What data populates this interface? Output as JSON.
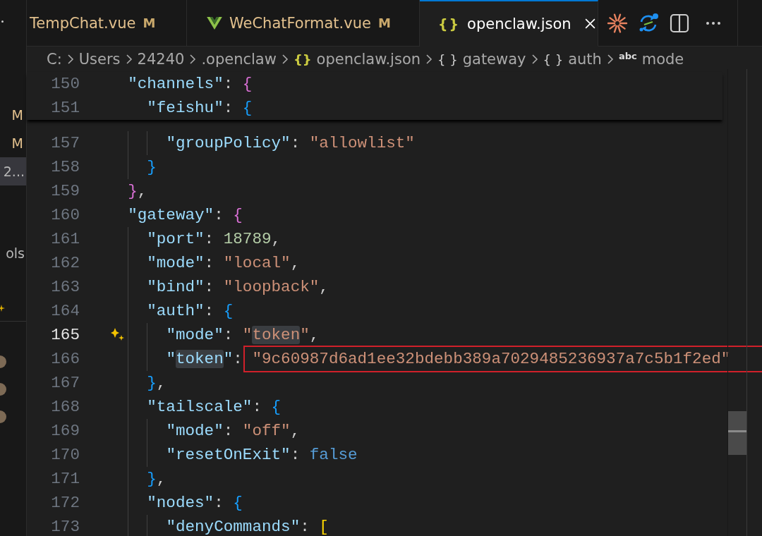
{
  "sidebar": {
    "items": [
      {
        "label": "M",
        "kind": "badge",
        "selected": false
      },
      {
        "label": "M",
        "kind": "badge",
        "selected": false
      },
      {
        "label": "2...",
        "kind": "entry",
        "selected": true
      },
      {
        "label": "ols",
        "kind": "entry",
        "selected": false
      }
    ]
  },
  "tabs": [
    {
      "label": "TempChat.vue",
      "badge": "M",
      "kind": "vue-cut",
      "selected": false
    },
    {
      "label": "WeChatFormat.vue",
      "badge": "M",
      "kind": "vue",
      "selected": false
    },
    {
      "label": "openclaw.json",
      "glyph": "{}",
      "kind": "json",
      "selected": true
    }
  ],
  "breadcrumb": [
    {
      "label": "C:"
    },
    {
      "label": "Users"
    },
    {
      "label": "24240"
    },
    {
      "label": ".openclaw"
    },
    {
      "glyph": "{}",
      "kind": "file",
      "label": "openclaw.json"
    },
    {
      "glyph": "{ }",
      "kind": "object",
      "label": "gateway"
    },
    {
      "glyph": "{ }",
      "kind": "object",
      "label": "auth"
    },
    {
      "glyph": "abc",
      "kind": "string",
      "label": "mode"
    }
  ],
  "sticky_lines": [
    {
      "number": "150",
      "tokens": [
        {
          "kind": "key",
          "text": "  \"channels\""
        },
        {
          "kind": "punct",
          "text": ": "
        },
        {
          "kind": "bracket",
          "color": "#da70d6",
          "text": "{"
        }
      ]
    },
    {
      "number": "151",
      "tokens": [
        {
          "kind": "key",
          "text": "    \"feishu\""
        },
        {
          "kind": "punct",
          "text": ": "
        },
        {
          "kind": "bracket",
          "color": "#179fff",
          "text": "{"
        }
      ]
    }
  ],
  "lines": [
    {
      "number": "157",
      "current": false,
      "tokens": [
        {
          "kind": "key",
          "text": "      \"groupPolicy\""
        },
        {
          "kind": "punct",
          "text": ": "
        },
        {
          "kind": "string",
          "text": "\"allowlist\""
        }
      ]
    },
    {
      "number": "158",
      "current": false,
      "tokens": [
        {
          "kind": "bracket",
          "color": "#179fff",
          "text": "    }"
        }
      ]
    },
    {
      "number": "159",
      "current": false,
      "tokens": [
        {
          "kind": "bracket",
          "color": "#da70d6",
          "text": "  }"
        },
        {
          "kind": "punct",
          "text": ","
        }
      ]
    },
    {
      "number": "160",
      "current": false,
      "tokens": [
        {
          "kind": "key",
          "text": "  \"gateway\""
        },
        {
          "kind": "punct",
          "text": ": "
        },
        {
          "kind": "bracket",
          "color": "#da70d6",
          "text": "{"
        }
      ]
    },
    {
      "number": "161",
      "current": false,
      "tokens": [
        {
          "kind": "key",
          "text": "    \"port\""
        },
        {
          "kind": "punct",
          "text": ": "
        },
        {
          "kind": "number",
          "text": "18789"
        },
        {
          "kind": "punct",
          "text": ","
        }
      ]
    },
    {
      "number": "162",
      "current": false,
      "tokens": [
        {
          "kind": "key",
          "text": "    \"mode\""
        },
        {
          "kind": "punct",
          "text": ": "
        },
        {
          "kind": "string",
          "text": "\"local\""
        },
        {
          "kind": "punct",
          "text": ","
        }
      ]
    },
    {
      "number": "163",
      "current": false,
      "tokens": [
        {
          "kind": "key",
          "text": "    \"bind\""
        },
        {
          "kind": "punct",
          "text": ": "
        },
        {
          "kind": "string",
          "text": "\"loopback\""
        },
        {
          "kind": "punct",
          "text": ","
        }
      ]
    },
    {
      "number": "164",
      "current": false,
      "tokens": [
        {
          "kind": "key",
          "text": "    \"auth\""
        },
        {
          "kind": "punct",
          "text": ": "
        },
        {
          "kind": "bracket",
          "color": "#179fff",
          "text": "{"
        }
      ]
    },
    {
      "number": "165",
      "current": true,
      "tokens": [
        {
          "kind": "key",
          "text": "      \"mode\""
        },
        {
          "kind": "punct",
          "text": ": "
        },
        {
          "kind": "string",
          "text": "\""
        },
        {
          "kind": "string-match",
          "text": "token"
        },
        {
          "kind": "string",
          "text": "\""
        },
        {
          "kind": "punct",
          "text": ","
        }
      ]
    },
    {
      "number": "166",
      "current": false,
      "tokens": [
        {
          "kind": "key",
          "text": "      \""
        },
        {
          "kind": "key-match",
          "text": "token"
        },
        {
          "kind": "key",
          "text": "\""
        },
        {
          "kind": "punct",
          "text": ": "
        },
        {
          "kind": "string-boxed",
          "text": "\"9c60987d6ad1ee32bdebb389a7029485236937a7c5b1f2ed\""
        }
      ]
    },
    {
      "number": "167",
      "current": false,
      "tokens": [
        {
          "kind": "bracket",
          "color": "#179fff",
          "text": "    }"
        },
        {
          "kind": "punct",
          "text": ","
        }
      ]
    },
    {
      "number": "168",
      "current": false,
      "tokens": [
        {
          "kind": "key",
          "text": "    \"tailscale\""
        },
        {
          "kind": "punct",
          "text": ": "
        },
        {
          "kind": "bracket",
          "color": "#179fff",
          "text": "{"
        }
      ]
    },
    {
      "number": "169",
      "current": false,
      "tokens": [
        {
          "kind": "key",
          "text": "      \"mode\""
        },
        {
          "kind": "punct",
          "text": ": "
        },
        {
          "kind": "string",
          "text": "\"off\""
        },
        {
          "kind": "punct",
          "text": ","
        }
      ]
    },
    {
      "number": "170",
      "current": false,
      "tokens": [
        {
          "kind": "key",
          "text": "      \"resetOnExit\""
        },
        {
          "kind": "punct",
          "text": ": "
        },
        {
          "kind": "keyword",
          "text": "false"
        }
      ]
    },
    {
      "number": "171",
      "current": false,
      "tokens": [
        {
          "kind": "bracket",
          "color": "#179fff",
          "text": "    }"
        },
        {
          "kind": "punct",
          "text": ","
        }
      ]
    },
    {
      "number": "172",
      "current": false,
      "tokens": [
        {
          "kind": "key",
          "text": "    \"nodes\""
        },
        {
          "kind": "punct",
          "text": ": "
        },
        {
          "kind": "bracket",
          "color": "#179fff",
          "text": "{"
        }
      ]
    },
    {
      "number": "173",
      "current": false,
      "tokens": [
        {
          "kind": "key",
          "text": "      \"denyCommands\""
        },
        {
          "kind": "punct",
          "text": ": "
        },
        {
          "kind": "bracket",
          "color": "#ffd700",
          "text": "["
        }
      ]
    }
  ]
}
